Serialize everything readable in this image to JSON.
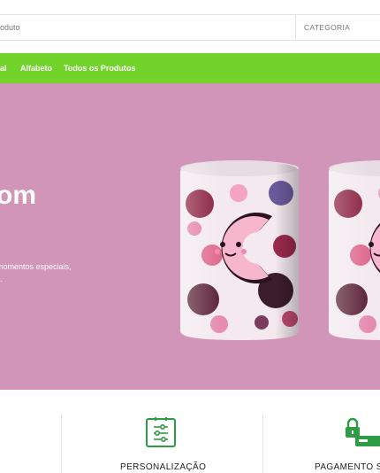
{
  "search": {
    "placeholder": "oduto",
    "category_label": "CATEGORIA"
  },
  "nav": {
    "items": [
      {
        "label": "tal"
      },
      {
        "label": "Alfabeto"
      },
      {
        "label": "Todos os Produtos"
      }
    ]
  },
  "hero": {
    "heading": "om",
    "description_line1": "momentos especiais,",
    "description_line2": "s.",
    "background_color": "#d195b7"
  },
  "features": [
    {
      "label": "PERSONALIZAÇÃO",
      "icon": "customize-sliders-icon"
    },
    {
      "label": "PAGAMENTO S",
      "icon": "secure-payment-icon"
    }
  ],
  "colors": {
    "accent_green": "#72d32a",
    "icon_green": "#2e9b45"
  }
}
